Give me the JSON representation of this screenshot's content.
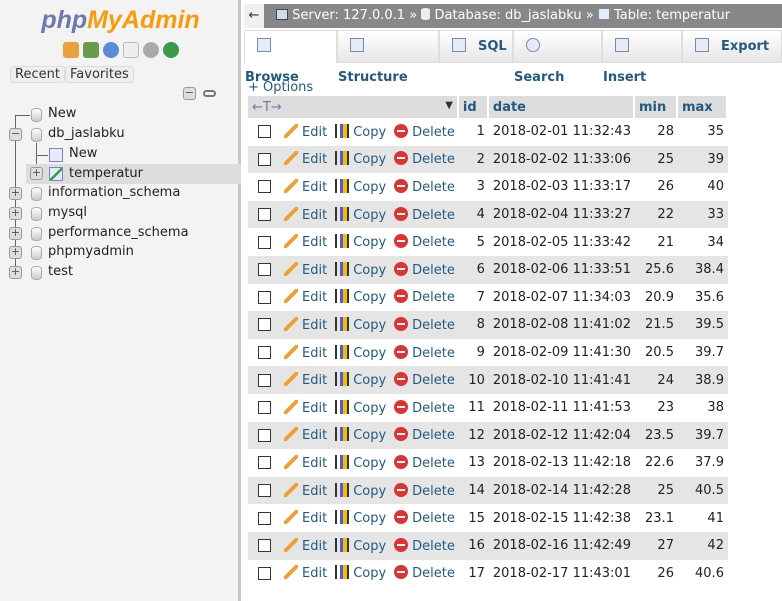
{
  "sidebar": {
    "logo_php": "php",
    "logo_myadmin": "MyAdmin",
    "recent": "Recent",
    "favorites": "Favorites",
    "tree": {
      "new": "New",
      "db": "db_jaslabku",
      "db_new": "New",
      "table": "temperatur",
      "others": [
        "information_schema",
        "mysql",
        "performance_schema",
        "phpmyadmin",
        "test"
      ]
    }
  },
  "breadcrumb": {
    "back": "←",
    "server": "Server: 127.0.0.1",
    "sep": "»",
    "database": "Database: db_jaslabku",
    "table": "Table: temperatur"
  },
  "tabs": [
    "Browse",
    "Structure",
    "SQL",
    "Search",
    "Insert",
    "Export"
  ],
  "options": "+ Options",
  "table": {
    "headers": {
      "arrows": "←T→",
      "id": "id",
      "date": "date",
      "min": "min",
      "max": "max"
    },
    "actions": {
      "edit": "Edit",
      "copy": "Copy",
      "delete": "Delete"
    },
    "rows": [
      [
        "1",
        "2018-02-01 11:32:43",
        "28",
        "35"
      ],
      [
        "2",
        "2018-02-02 11:33:06",
        "25",
        "39"
      ],
      [
        "3",
        "2018-02-03 11:33:17",
        "26",
        "40"
      ],
      [
        "4",
        "2018-02-04 11:33:27",
        "22",
        "33"
      ],
      [
        "5",
        "2018-02-05 11:33:42",
        "21",
        "34"
      ],
      [
        "6",
        "2018-02-06 11:33:51",
        "25.6",
        "38.4"
      ],
      [
        "7",
        "2018-02-07 11:34:03",
        "20.9",
        "35.6"
      ],
      [
        "8",
        "2018-02-08 11:41:02",
        "21.5",
        "39.5"
      ],
      [
        "9",
        "2018-02-09 11:41:30",
        "20.5",
        "39.7"
      ],
      [
        "10",
        "2018-02-10 11:41:41",
        "24",
        "38.9"
      ],
      [
        "11",
        "2018-02-11 11:41:53",
        "23",
        "38"
      ],
      [
        "12",
        "2018-02-12 11:42:04",
        "23.5",
        "39.7"
      ],
      [
        "13",
        "2018-02-13 11:42:18",
        "22.6",
        "37.9"
      ],
      [
        "14",
        "2018-02-14 11:42:28",
        "25",
        "40.5"
      ],
      [
        "15",
        "2018-02-15 11:42:38",
        "23.1",
        "41"
      ],
      [
        "16",
        "2018-02-16 11:42:49",
        "27",
        "42"
      ],
      [
        "17",
        "2018-02-17 11:43:01",
        "26",
        "40.6"
      ]
    ]
  }
}
